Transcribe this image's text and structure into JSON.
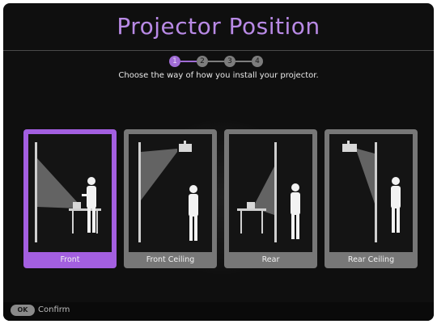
{
  "title": "Projector Position",
  "steps": [
    {
      "number": "1",
      "active": true
    },
    {
      "number": "2",
      "active": false
    },
    {
      "number": "3",
      "active": false
    },
    {
      "number": "4",
      "active": false
    }
  ],
  "instruction": "Choose the way of how you install your projector.",
  "options": [
    {
      "label": "Front",
      "selected": true
    },
    {
      "label": "Front Ceiling",
      "selected": false
    },
    {
      "label": "Rear",
      "selected": false
    },
    {
      "label": "Rear Ceiling",
      "selected": false
    }
  ],
  "footer": {
    "ok_label": "OK",
    "confirm_label": "Confirm"
  },
  "colors": {
    "accent": "#a35fe0",
    "title": "#b98ae6",
    "card": "#777777",
    "background": "#0f0f0f"
  }
}
